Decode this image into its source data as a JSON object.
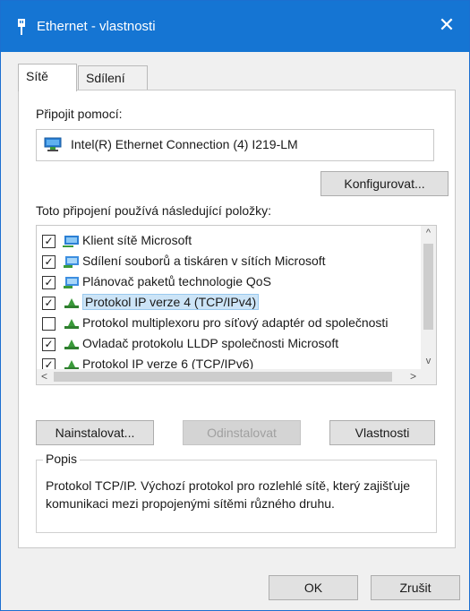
{
  "window": {
    "title": "Ethernet - vlastnosti",
    "close_glyph": "✕",
    "accent": "#1575d3"
  },
  "tabs": [
    {
      "label": "Sítě",
      "active": true
    },
    {
      "label": "Sdílení",
      "active": false
    }
  ],
  "connect_using": {
    "label": "Připojit pomocí:",
    "adapter": "Intel(R) Ethernet Connection (4) I219-LM",
    "icon": "network-adapter-icon"
  },
  "configure_button": "Konfigurovat...",
  "items_label": "Toto připojení používá následující položky:",
  "items": [
    {
      "label": "Klient sítě Microsoft",
      "checked": true,
      "icon": "network-client-icon"
    },
    {
      "label": "Sdílení souborů a tiskáren v sítích Microsoft",
      "checked": true,
      "icon": "network-service-icon"
    },
    {
      "label": "Plánovač paketů technologie QoS",
      "checked": true,
      "icon": "network-service-icon"
    },
    {
      "label": "Protokol IP verze 4 (TCP/IPv4)",
      "checked": true,
      "selected": true,
      "icon": "protocol-icon"
    },
    {
      "label": "Protokol multiplexoru pro síťový adaptér od společnosti",
      "checked": false,
      "icon": "protocol-icon"
    },
    {
      "label": "Ovladač protokolu LLDP společnosti Microsoft",
      "checked": true,
      "icon": "protocol-icon"
    },
    {
      "label": "Protokol IP verze 6 (TCP/IPv6)",
      "checked": true,
      "icon": "protocol-icon"
    }
  ],
  "check_glyph": "✓",
  "scroll": {
    "up": "^",
    "down": "v",
    "left": "<",
    "right": ">"
  },
  "buttons": {
    "install": "Nainstalovat...",
    "uninstall": "Odinstalovat",
    "properties": "Vlastnosti",
    "ok": "OK",
    "cancel": "Zrušit"
  },
  "description": {
    "legend": "Popis",
    "text": "Protokol TCP/IP. Výchozí protokol pro rozlehlé sítě, který zajišťuje komunikaci mezi propojenými sítěmi různého druhu."
  }
}
